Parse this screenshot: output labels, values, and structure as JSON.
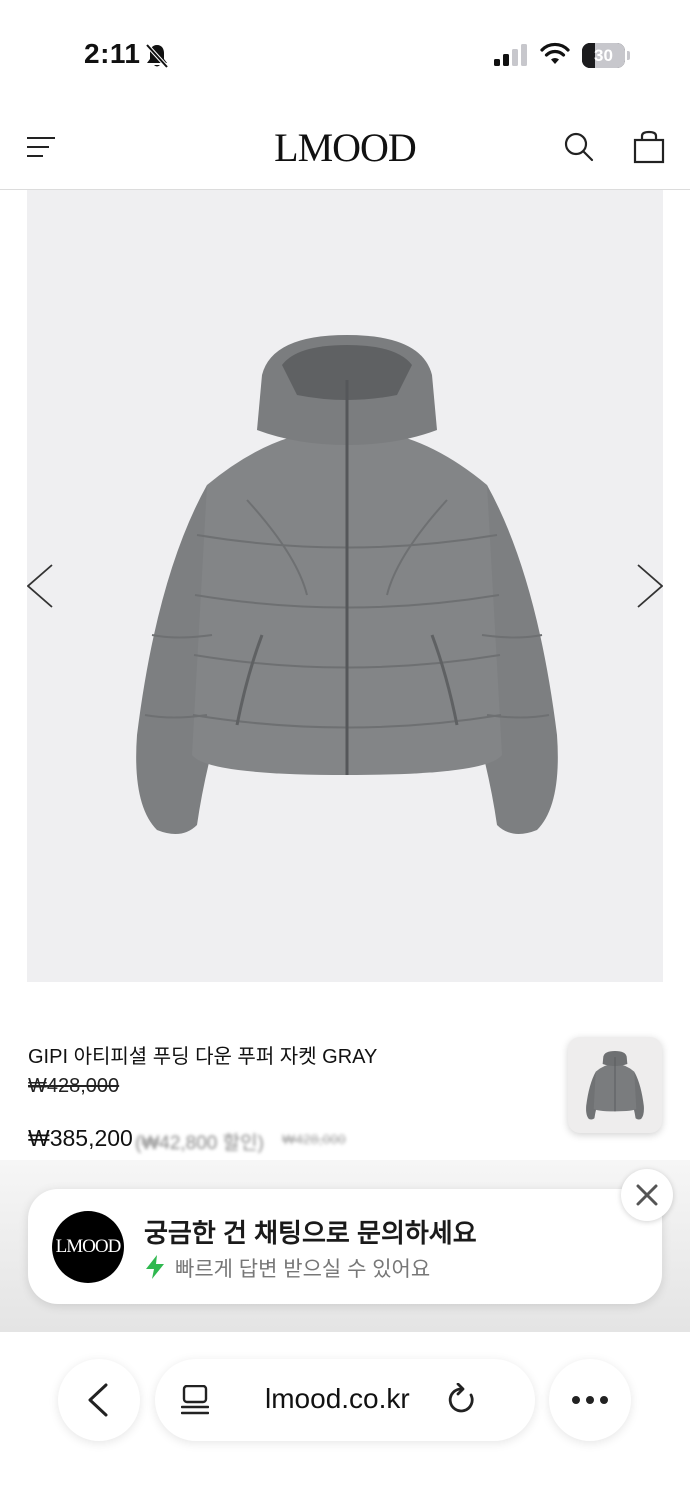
{
  "status_bar": {
    "time": "2:11",
    "battery_level": "30",
    "icons": [
      "bell-slash-icon",
      "cellular-signal-icon",
      "wifi-icon",
      "battery-icon"
    ]
  },
  "header": {
    "logo": "LMOOD",
    "icons": [
      "hamburger-menu-icon",
      "search-icon",
      "shopping-bag-icon"
    ]
  },
  "gallery": {
    "image": "gray-puffer-jacket",
    "prev_icon": "chevron-left-icon",
    "next_icon": "chevron-right-icon"
  },
  "product": {
    "name": "GIPI 아티피셜 푸딩 다운 푸퍼 자켓 GRAY",
    "original_price": "₩428,000",
    "sale_price": "₩385,200",
    "discount_note": "(₩42,800 할인)",
    "small_strike_price": "₩428,000"
  },
  "chat": {
    "avatar_text": "LMOOD",
    "title": "궁금한 건 채팅으로 문의하세요",
    "subtitle": "빠르게 답변 받으실 수 있어요",
    "accent_color": "#2fb84f"
  },
  "browser": {
    "url": "lmood.co.kr"
  }
}
